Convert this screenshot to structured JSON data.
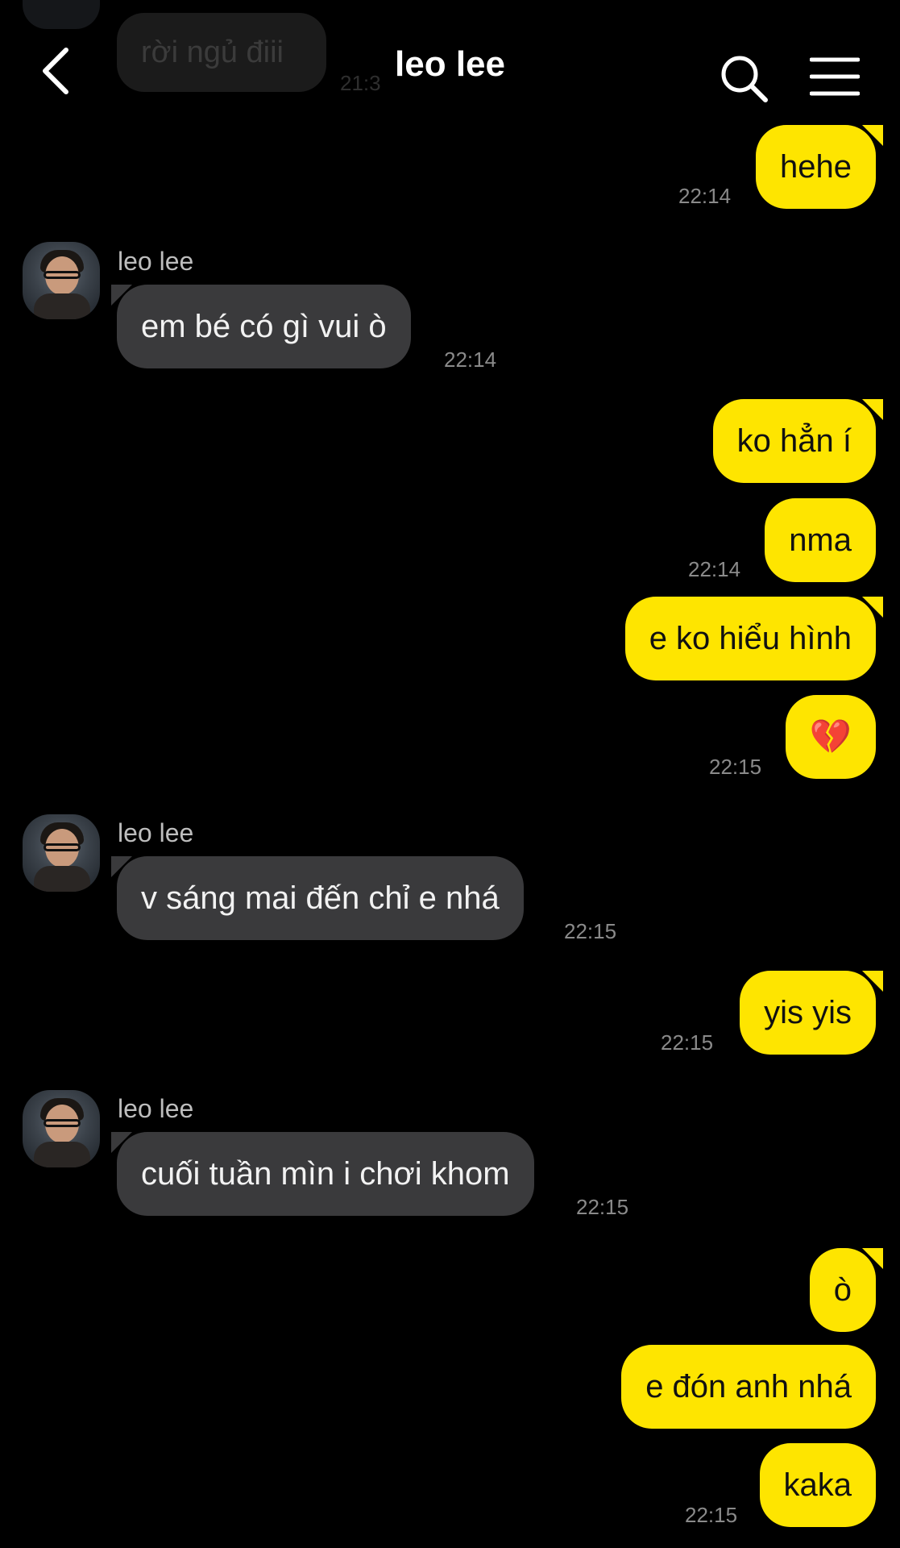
{
  "header": {
    "title": "leo lee",
    "faded_message": "rời ngủ điii",
    "faded_time": "21:3"
  },
  "messages": [
    {
      "dir": "out",
      "text": "hehe",
      "time": "22:14"
    },
    {
      "dir": "in",
      "sender": "leo lee",
      "text": "em bé có gì vui ò",
      "time": "22:14"
    },
    {
      "dir": "out",
      "text": "ko hẳn í"
    },
    {
      "dir": "out",
      "text": "nma",
      "time": "22:14"
    },
    {
      "dir": "out",
      "text": "e ko hiểu hình"
    },
    {
      "dir": "out",
      "text": "💔",
      "time": "22:15"
    },
    {
      "dir": "in",
      "sender": "leo lee",
      "text": "v sáng mai đến chỉ e nhá",
      "time": "22:15"
    },
    {
      "dir": "out",
      "text": "yis yis",
      "time": "22:15"
    },
    {
      "dir": "in",
      "sender": "leo lee",
      "text": "cuối tuần mìn i chơi khom",
      "time": "22:15"
    },
    {
      "dir": "out",
      "text": "ò"
    },
    {
      "dir": "out",
      "text": "e đón anh nhá"
    },
    {
      "dir": "out",
      "text": "kaka",
      "time": "22:15"
    }
  ],
  "colors": {
    "background": "#000000",
    "outgoing_bubble": "#FEE500",
    "incoming_bubble": "#3a3a3c",
    "timestamp": "#8a8a8a"
  },
  "icons": {
    "back": "chevron-left-icon",
    "search": "search-icon",
    "menu": "hamburger-menu-icon"
  }
}
